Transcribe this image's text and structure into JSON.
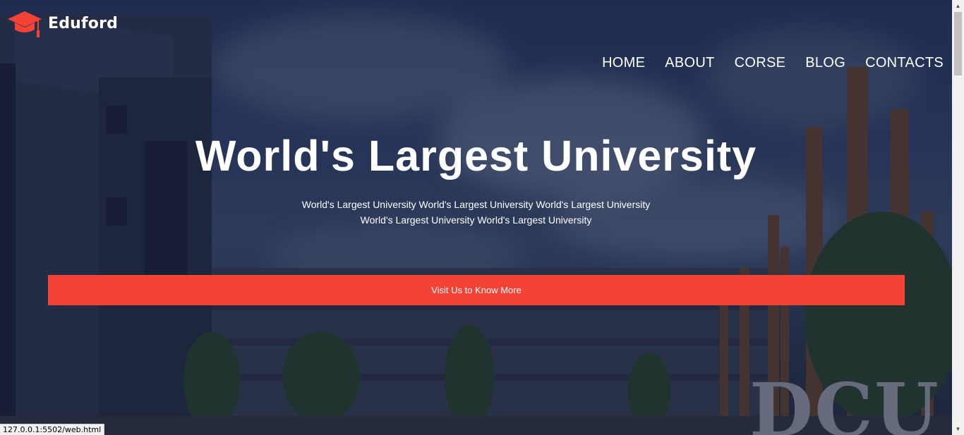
{
  "brand": {
    "name": "Eduford",
    "logo_icon": "graduation-cap-icon",
    "logo_color": "#f44336"
  },
  "nav": {
    "items": [
      {
        "label": "HOME"
      },
      {
        "label": "ABOUT"
      },
      {
        "label": "CORSE"
      },
      {
        "label": "BLOG"
      },
      {
        "label": "CONTACTS"
      }
    ]
  },
  "hero": {
    "title": "World's Largest University",
    "subtitle_line1": "World's Largest University World's Largest University World's Largest University",
    "subtitle_line2": "World's Largest University World's Largest University",
    "cta_label": "Visit Us to Know More",
    "cta_color": "#f44336",
    "background_sign": "DCU"
  },
  "browser": {
    "status_url": "127.0.0.1:5502/web.html"
  }
}
